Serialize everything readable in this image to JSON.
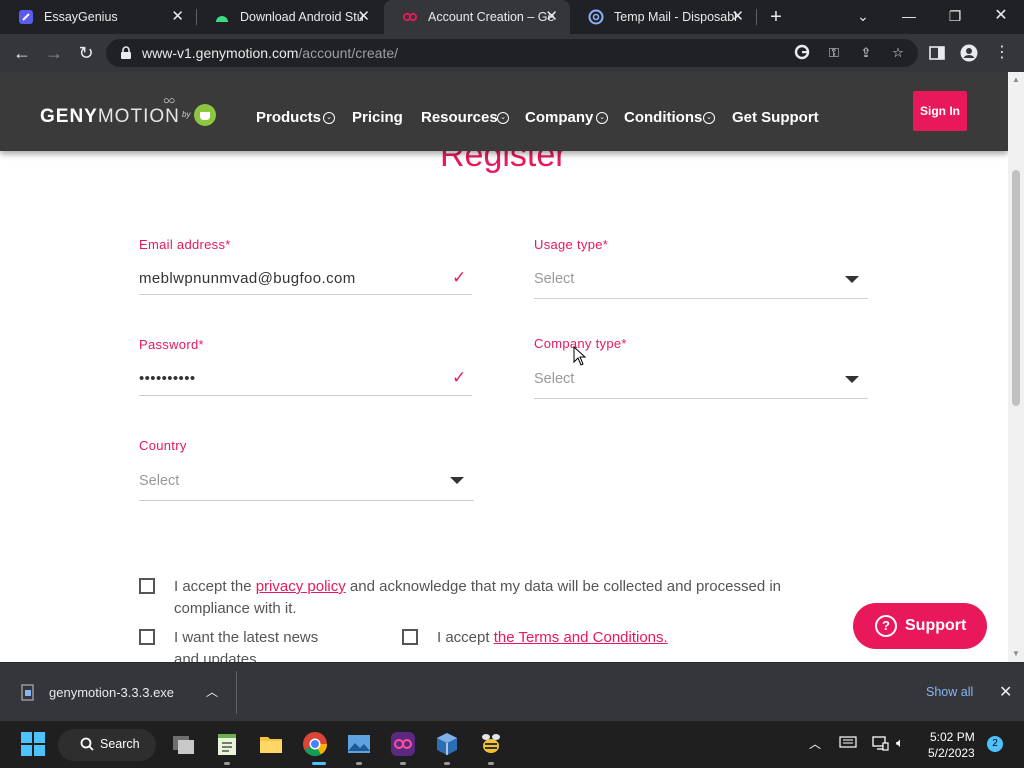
{
  "browser": {
    "tabs": [
      {
        "title": "EssayGenius",
        "icon": "essaygenius-icon",
        "active": false
      },
      {
        "title": "Download Android Stu",
        "icon": "android-icon",
        "active": false
      },
      {
        "title": "Account Creation – Ge",
        "icon": "genymotion-icon",
        "active": true
      },
      {
        "title": "Temp Mail - Disposabl",
        "icon": "tempmail-icon",
        "active": false
      }
    ],
    "url_host": "www-v1.genymotion.com",
    "url_path": "/account/create/"
  },
  "site": {
    "logo_bold": "GENY",
    "logo_light": "MOTION",
    "logo_by": "by",
    "nav": [
      {
        "label": "Products",
        "dropdown": true
      },
      {
        "label": "Pricing",
        "dropdown": false
      },
      {
        "label": "Resources",
        "dropdown": true
      },
      {
        "label": "Company",
        "dropdown": true
      },
      {
        "label": "Conditions",
        "dropdown": true
      },
      {
        "label": "Get Support",
        "dropdown": false
      }
    ],
    "signin_label": "Sign In",
    "accent": "#e8185a"
  },
  "form": {
    "title": "Register",
    "email": {
      "label": "Email address*",
      "value": "meblwpnunmvad@bugfoo.com"
    },
    "password": {
      "label": "Password*",
      "value": "••••••••••"
    },
    "country": {
      "label": "Country",
      "placeholder": "Select"
    },
    "usage_type": {
      "label": "Usage type*",
      "placeholder": "Select"
    },
    "company_type": {
      "label": "Company type*",
      "placeholder": "Select"
    },
    "privacy": {
      "text_before": "I accept the ",
      "link": "privacy policy",
      "text_after": " and acknowledge that my data will be collected and processed in",
      "line2": "compliance with it."
    },
    "newsletter": {
      "line1": "I want the latest news",
      "line2": "and updates"
    },
    "terms": {
      "text_before": "I accept ",
      "link": "the Terms and Conditions."
    }
  },
  "support_label": "Support",
  "downloads": {
    "file_name": "genymotion-3.3.3.exe",
    "show_all": "Show all"
  },
  "taskbar": {
    "search_label": "Search",
    "time": "5:02 PM",
    "date": "5/2/2023",
    "notifications": "2"
  }
}
